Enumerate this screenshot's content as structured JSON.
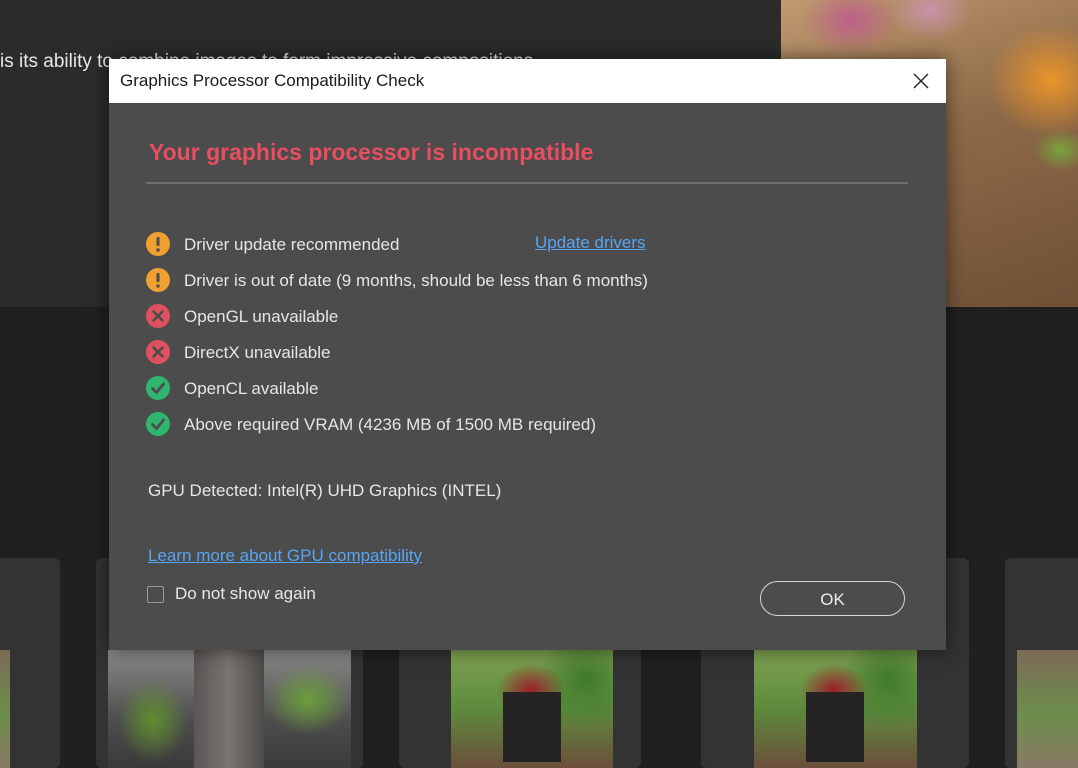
{
  "background": {
    "heading_text": "is its ability to combine images to form impressive compositions"
  },
  "dialog": {
    "title": "Graphics Processor Compatibility Check",
    "headline": "Your graphics processor is incompatible",
    "checks": [
      {
        "status": "warning",
        "icon": "warning-icon",
        "label": "Driver update recommended"
      },
      {
        "status": "warning",
        "icon": "warning-icon",
        "label": "Driver is out of date (9 months, should be less than 6 months)"
      },
      {
        "status": "error",
        "icon": "error-icon",
        "label": "OpenGL unavailable"
      },
      {
        "status": "error",
        "icon": "error-icon",
        "label": "DirectX unavailable"
      },
      {
        "status": "ok",
        "icon": "check-icon",
        "label": "OpenCL available"
      },
      {
        "status": "ok",
        "icon": "check-icon",
        "label": "Above required VRAM (4236 MB of 1500 MB required)"
      }
    ],
    "update_link": "Update drivers",
    "gpu_detected": "GPU Detected: Intel(R) UHD Graphics (INTEL)",
    "learn_more_link": "Learn more about GPU compatibility",
    "dont_show_label": "Do not show again",
    "dont_show_checked": false,
    "ok_label": "OK"
  },
  "colors": {
    "headline": "#e84e5f",
    "warning": "#f0a030",
    "error": "#e0505f",
    "ok": "#2fb56f",
    "link": "#57a5f4"
  }
}
